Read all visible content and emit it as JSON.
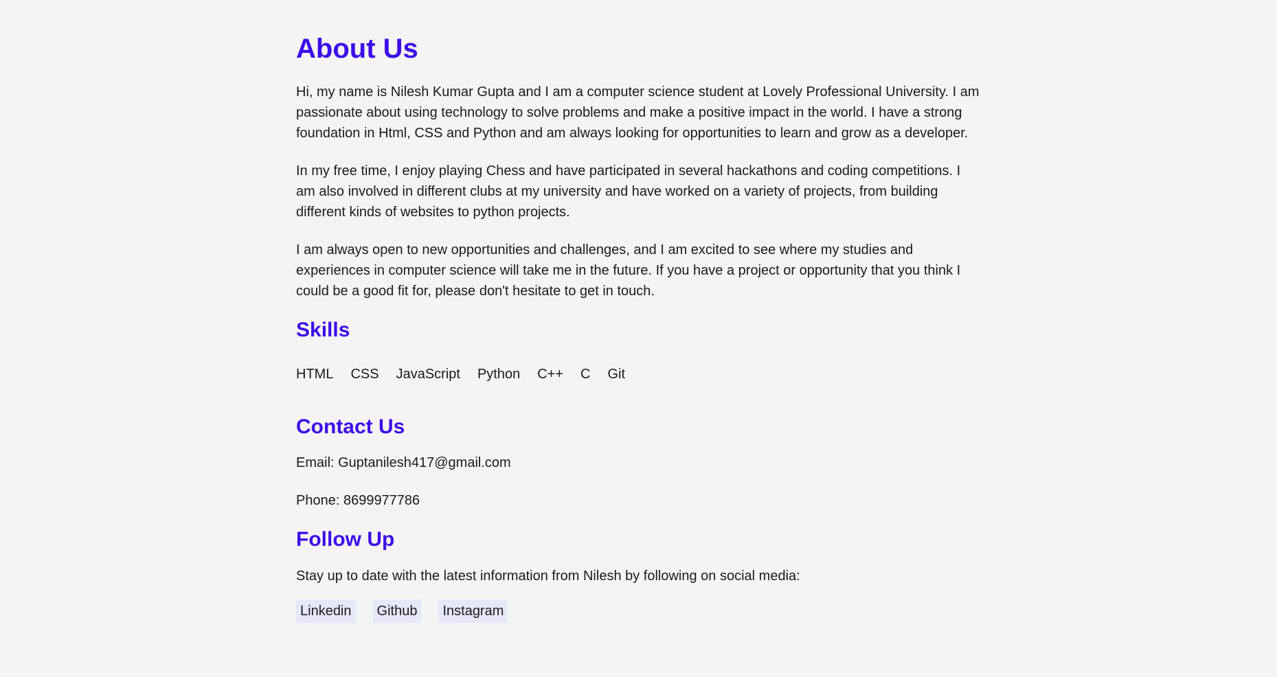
{
  "about": {
    "title": "About Us",
    "paragraphs": [
      "Hi, my name is Nilesh Kumar Gupta and I am a computer science student at Lovely Professional University. I am passionate about using technology to solve problems and make a positive impact in the world. I have a strong foundation in Html, CSS and Python and am always looking for opportunities to learn and grow as a developer.",
      "In my free time, I enjoy playing Chess and have participated in several hackathons and coding competitions. I am also involved in different clubs at my university and have worked on a variety of projects, from building different kinds of websites to python projects.",
      "I am always open to new opportunities and challenges, and I am excited to see where my studies and experiences in computer science will take me in the future. If you have a project or opportunity that you think I could be a good fit for, please don't hesitate to get in touch."
    ]
  },
  "skills": {
    "title": "Skills",
    "items": [
      "HTML",
      "CSS",
      "JavaScript",
      "Python",
      "C++",
      "C",
      "Git"
    ]
  },
  "contact": {
    "title": "Contact Us",
    "email": "Email: Guptanilesh417@gmail.com",
    "phone": "Phone: 8699977786"
  },
  "follow": {
    "title": "Follow Up",
    "text": "Stay up to date with the latest information from Nilesh by following on social media:",
    "links": [
      "Linkedin",
      "Github",
      "Instagram"
    ]
  },
  "colors": {
    "heading": "#3d0ce8",
    "background": "#f4f4f4",
    "link_background": "#e6e8fa"
  }
}
